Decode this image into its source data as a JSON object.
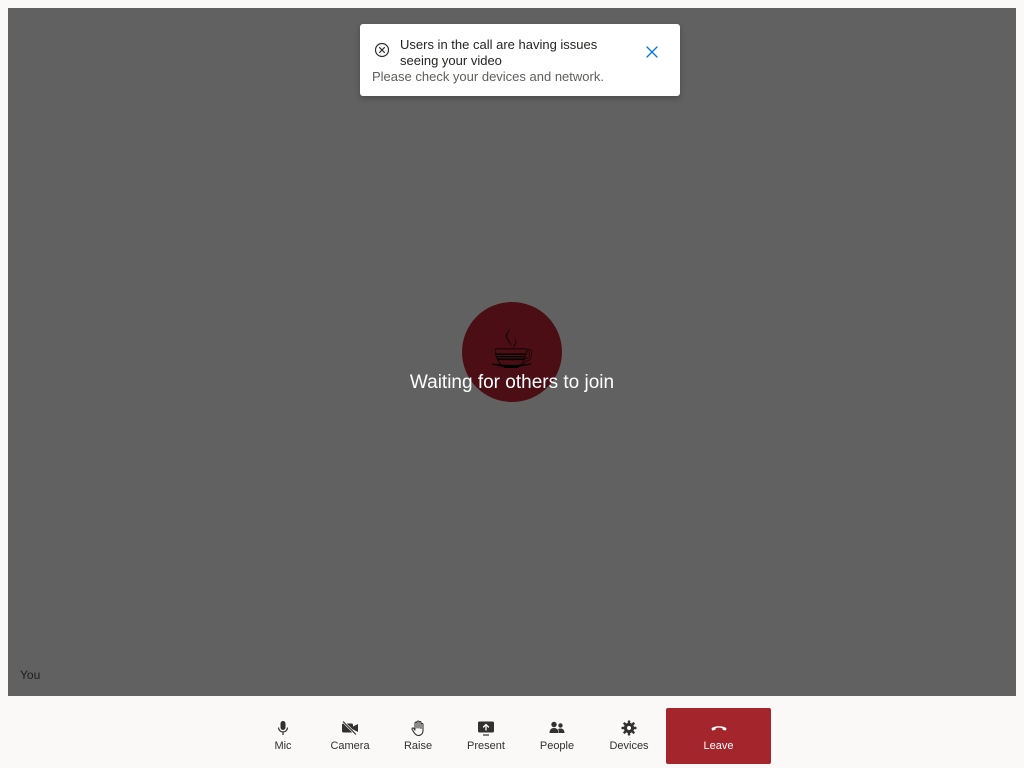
{
  "toast": {
    "title": "Users in the call are having issues seeing your video",
    "body": "Please check your devices and network.",
    "icon": "error-circle-icon",
    "close_icon": "close-icon"
  },
  "stage": {
    "avatar_emoji": "☕",
    "waiting_text": "Waiting for others to join",
    "self_label": "You"
  },
  "controls": {
    "mic": "Mic",
    "camera": "Camera",
    "raise": "Raise",
    "present": "Present",
    "people": "People",
    "devices": "Devices",
    "leave": "Leave"
  },
  "colors": {
    "stage_bg": "#616161",
    "avatar_bg": "#4a0e14",
    "leave_bg": "#a4262c",
    "accent": "#0078d4"
  }
}
